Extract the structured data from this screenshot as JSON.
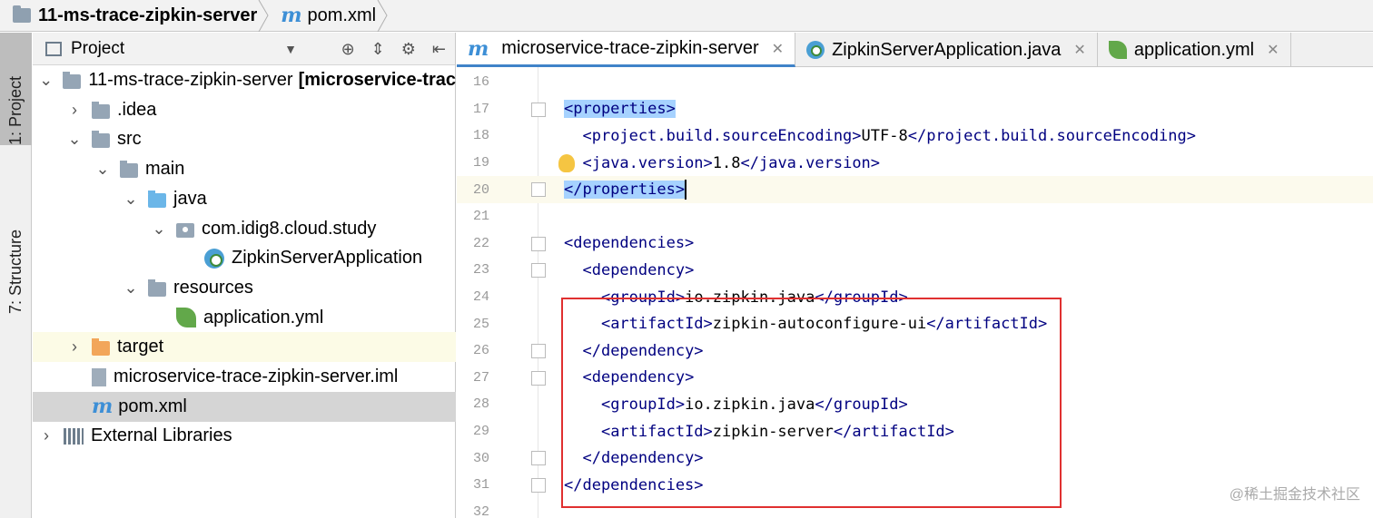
{
  "breadcrumb": {
    "project": "11-ms-trace-zipkin-server",
    "file": "pom.xml"
  },
  "toolwindows": {
    "project": "1: Project",
    "structure": "7: Structure"
  },
  "project_panel": {
    "title": "Project",
    "tree": [
      {
        "label": "11-ms-trace-zipkin-server",
        "extra": "[microservice-trac",
        "depth": 0,
        "arrow": "expanded",
        "icon": "module-folder-icon"
      },
      {
        "label": ".idea",
        "depth": 1,
        "arrow": "collapsed",
        "icon": "folder-icon"
      },
      {
        "label": "src",
        "depth": 1,
        "arrow": "expanded",
        "icon": "folder-icon"
      },
      {
        "label": "main",
        "depth": 2,
        "arrow": "expanded",
        "icon": "folder-icon"
      },
      {
        "label": "java",
        "depth": 3,
        "arrow": "expanded",
        "icon": "source-folder-icon"
      },
      {
        "label": "com.idig8.cloud.study",
        "depth": 4,
        "arrow": "expanded",
        "icon": "package-icon"
      },
      {
        "label": "ZipkinServerApplication",
        "depth": 5,
        "arrow": "none",
        "icon": "spring-boot-class-icon"
      },
      {
        "label": "resources",
        "depth": 3,
        "arrow": "expanded",
        "icon": "resources-folder-icon"
      },
      {
        "label": "application.yml",
        "depth": 4,
        "arrow": "none",
        "icon": "spring-yml-icon"
      },
      {
        "label": "target",
        "depth": 1,
        "arrow": "collapsed",
        "icon": "excluded-folder-icon"
      },
      {
        "label": "microservice-trace-zipkin-server.iml",
        "depth": 1,
        "arrow": "none",
        "icon": "iml-file-icon"
      },
      {
        "label": "pom.xml",
        "depth": 1,
        "arrow": "none",
        "icon": "maven-icon"
      },
      {
        "label": "External Libraries",
        "depth": 0,
        "arrow": "collapsed",
        "icon": "libraries-icon"
      }
    ]
  },
  "editor": {
    "tabs": [
      {
        "label": "microservice-trace-zipkin-server",
        "icon": "maven-icon",
        "active": true
      },
      {
        "label": "ZipkinServerApplication.java",
        "icon": "spring-boot-class-icon",
        "active": false
      },
      {
        "label": "application.yml",
        "icon": "spring-yml-icon",
        "active": false
      }
    ],
    "lines": [
      {
        "num": "16",
        "text": ""
      },
      {
        "num": "17",
        "text": "<properties>"
      },
      {
        "num": "18",
        "text": "  <project.build.sourceEncoding>UTF-8</project.build.sourceEncoding>"
      },
      {
        "num": "19",
        "text": "  <java.version>1.8</java.version>"
      },
      {
        "num": "20",
        "text": "</properties>"
      },
      {
        "num": "21",
        "text": ""
      },
      {
        "num": "22",
        "text": "<dependencies>"
      },
      {
        "num": "23",
        "text": "  <dependency>"
      },
      {
        "num": "24",
        "text": "    <groupId>io.zipkin.java</groupId>"
      },
      {
        "num": "25",
        "text": "    <artifactId>zipkin-autoconfigure-ui</artifactId>"
      },
      {
        "num": "26",
        "text": "  </dependency>"
      },
      {
        "num": "27",
        "text": "  <dependency>"
      },
      {
        "num": "28",
        "text": "    <groupId>io.zipkin.java</groupId>"
      },
      {
        "num": "29",
        "text": "    <artifactId>zipkin-server</artifactId>"
      },
      {
        "num": "30",
        "text": "  </dependency>"
      },
      {
        "num": "31",
        "text": "</dependencies>"
      },
      {
        "num": "32",
        "text": ""
      }
    ],
    "watermark": "@稀土掘金技术社区"
  },
  "colors": {
    "tag": "#000080",
    "selection": "#a6d2ff",
    "highlight_box": "#e03030",
    "current_line": "#fcfaed"
  }
}
